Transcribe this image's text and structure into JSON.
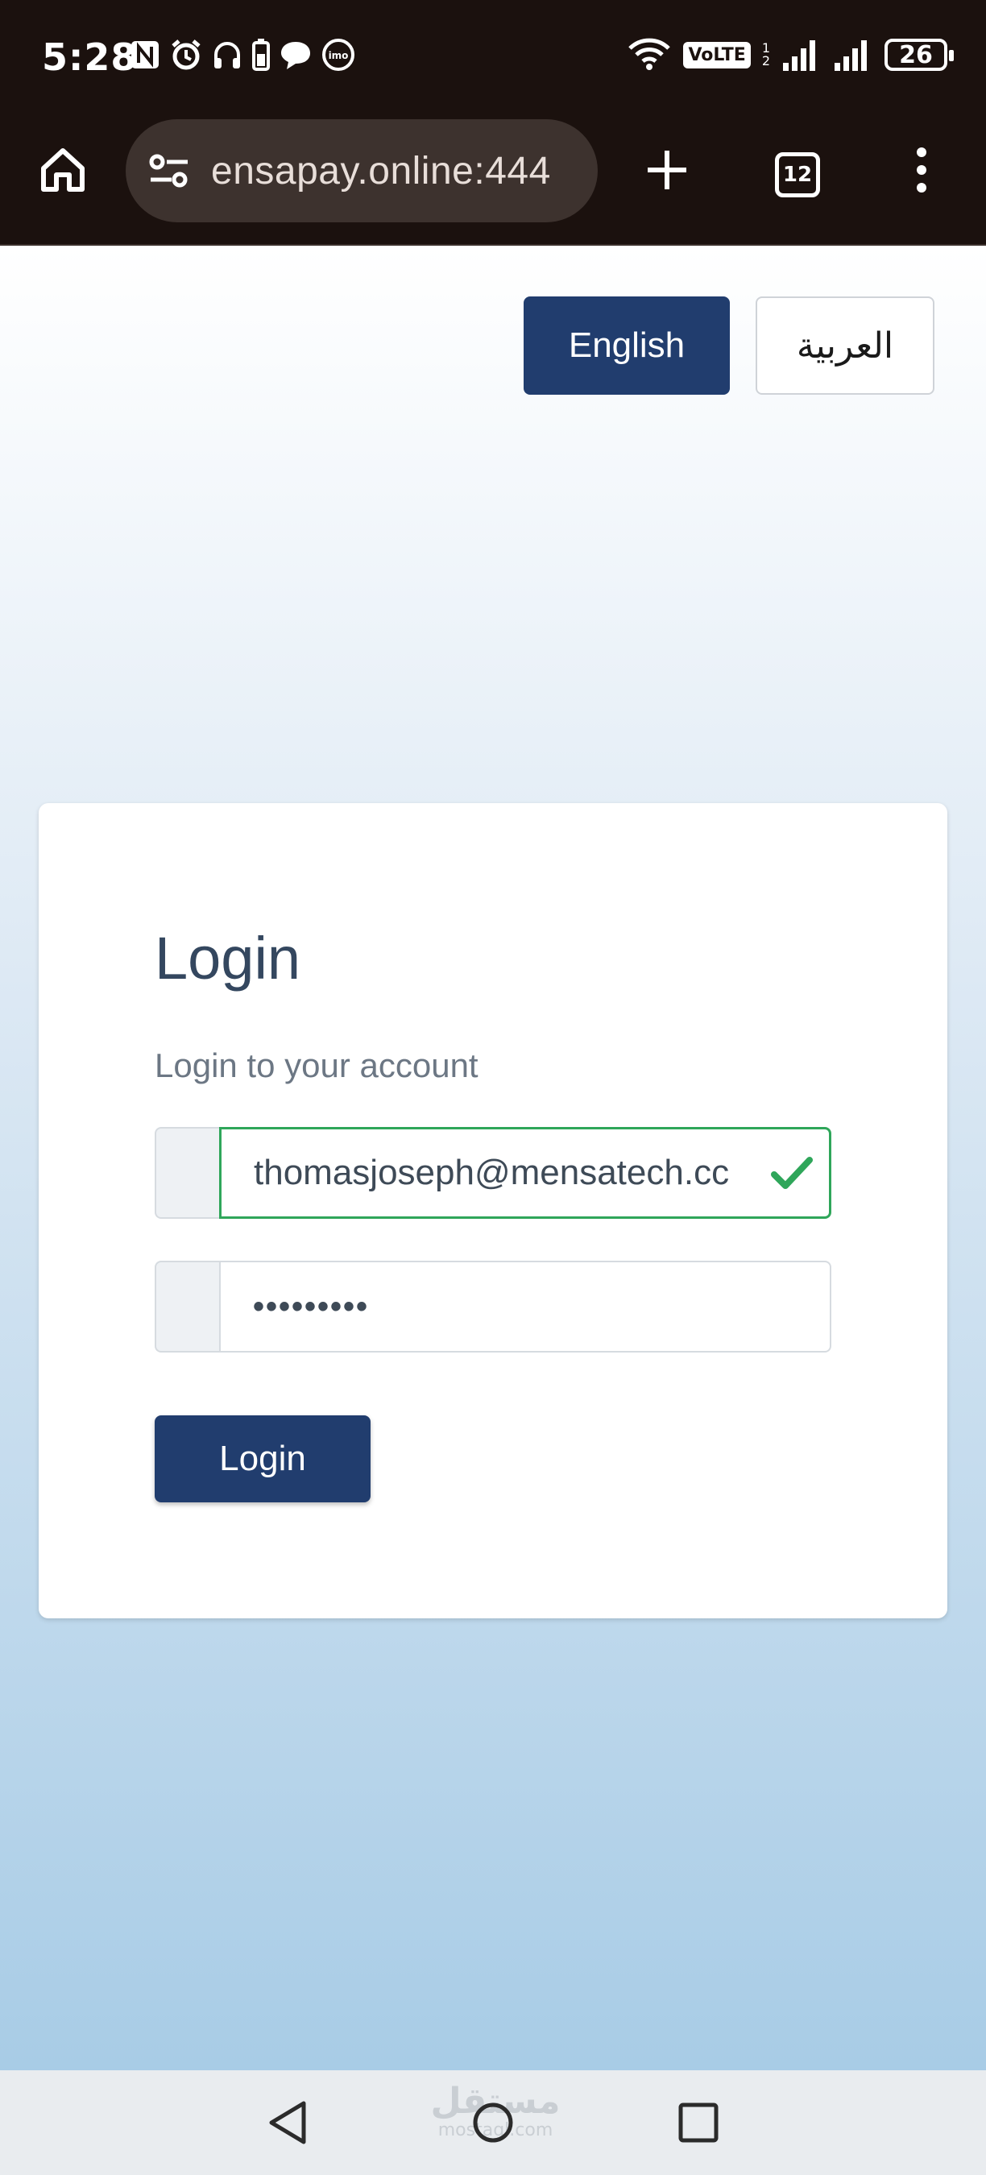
{
  "status_bar": {
    "time": "5:28",
    "battery": "26",
    "volte": "VoLTE",
    "volte_sub_top": "1",
    "volte_sub_bottom": "2",
    "icons": [
      "nfc-icon",
      "alarm-icon",
      "headphones-icon",
      "battery-saver-icon",
      "chat-icon",
      "imo-icon",
      "wifi-icon",
      "signal-icon",
      "signal-icon",
      "battery-icon"
    ]
  },
  "browser": {
    "url": "ensapay.online:444",
    "tab_count": "12",
    "icons": [
      "home-icon",
      "site-settings-icon",
      "new-tab-icon",
      "tabs-icon",
      "more-menu-icon"
    ]
  },
  "language": {
    "english_label": "English",
    "arabic_label": "العربية",
    "active_color": "#213d6e"
  },
  "login": {
    "title": "Login",
    "subtitle": "Login to your account",
    "email_value": "thomasjoseph@mensatech.cc",
    "password_mask": "•••••••••",
    "button_label": "Login",
    "valid_color": "#2fa65a",
    "icons": [
      "check-icon"
    ]
  },
  "watermark": {
    "arabic": "مستقل",
    "latin": "mostaql.com"
  },
  "navbar": {
    "icons": [
      "back-icon",
      "home-circle-icon",
      "recents-icon"
    ]
  }
}
